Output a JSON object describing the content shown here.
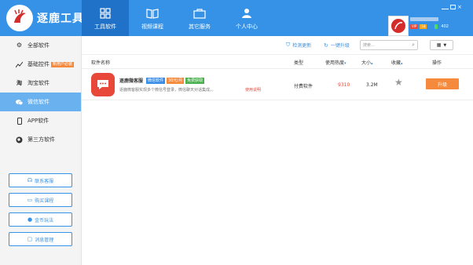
{
  "app": {
    "title": "逐鹿工具箱"
  },
  "nav": [
    {
      "label": "工具软件",
      "icon": "grid-icon",
      "active": true
    },
    {
      "label": "视频课程",
      "icon": "book-icon",
      "active": false
    },
    {
      "label": "其它服务",
      "icon": "briefcase-icon",
      "active": false
    },
    {
      "label": "个人中心",
      "icon": "person-icon",
      "active": false
    }
  ],
  "user": {
    "vip": "VIP",
    "level": "18",
    "coins": "402"
  },
  "sidebar": {
    "items": [
      {
        "label": "全部软件",
        "icon": "gears-icon"
      },
      {
        "label": "基础控件",
        "icon": "trend-icon",
        "tag": "新用户必装"
      },
      {
        "label": "淘宝软件",
        "icon": "taobao-icon"
      },
      {
        "label": "微信软件",
        "icon": "wechat-icon",
        "active": true
      },
      {
        "label": "APP软件",
        "icon": "phone-icon"
      },
      {
        "label": "第三方软件",
        "icon": "globe-icon"
      }
    ],
    "buttons": [
      {
        "label": "联系客服",
        "icon": "headset-icon"
      },
      {
        "label": "购买课程",
        "icon": "cart-icon"
      },
      {
        "label": "金币玩法",
        "icon": "coin-icon"
      },
      {
        "label": "消息管理",
        "icon": "message-icon"
      }
    ]
  },
  "toolbar": {
    "check_update": "检测更新",
    "one_click_upgrade": "一键升级",
    "search_placeholder": "搜索..."
  },
  "table": {
    "headers": {
      "name": "软件名称",
      "type": "类型",
      "heat": "使用热度",
      "size": "大小",
      "fav": "收藏",
      "action": "操作"
    },
    "rows": [
      {
        "name": "逐鹿微客服",
        "tags": [
          "微信软件",
          "30元/月",
          "免费获取"
        ],
        "desc": "逐鹿微客服实现多个微信号登录，微信聊天对话集成。。",
        "tutorial": "使用说明",
        "type": "付费软件",
        "heat": "9310",
        "size": "3.2M",
        "action": "升级"
      }
    ]
  },
  "colors": {
    "primary": "#3592e6",
    "accent": "#f58a3d",
    "danger": "#e94a3a"
  }
}
